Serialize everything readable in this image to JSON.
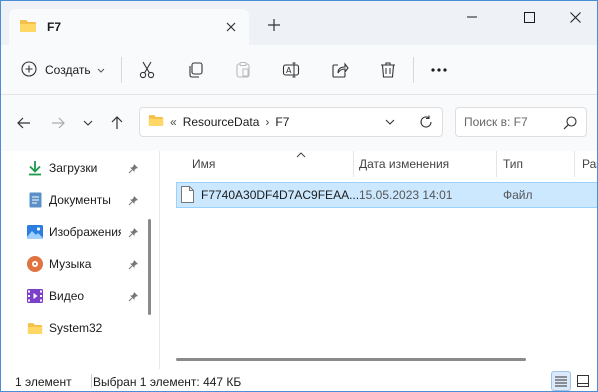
{
  "window": {
    "tab_title": "F7"
  },
  "commandbar": {
    "create_label": "Создать",
    "icons": [
      "cut-icon",
      "copy-icon",
      "paste-icon",
      "rename-icon",
      "share-icon",
      "delete-icon",
      "more-icon"
    ]
  },
  "address": {
    "overflow": "«",
    "crumbs": [
      "ResourceData",
      "F7"
    ],
    "separator": "›"
  },
  "search": {
    "placeholder": "Поиск в: F7"
  },
  "sidebar": {
    "items": [
      {
        "label": "Загрузки",
        "icon": "downloads-icon",
        "pinned": true
      },
      {
        "label": "Документы",
        "icon": "documents-icon",
        "pinned": true
      },
      {
        "label": "Изображения",
        "icon": "pictures-icon",
        "pinned": true
      },
      {
        "label": "Музыка",
        "icon": "music-icon",
        "pinned": true
      },
      {
        "label": "Видео",
        "icon": "videos-icon",
        "pinned": true
      },
      {
        "label": "System32",
        "icon": "folder-icon",
        "pinned": false
      }
    ]
  },
  "list": {
    "columns": [
      "Имя",
      "Дата изменения",
      "Тип",
      "Раз"
    ],
    "rows": [
      {
        "name": "F7740A30DF4D7AC9FEAA...",
        "date": "15.05.2023 14:01",
        "type": "Файл",
        "selected": true
      }
    ]
  },
  "status": {
    "count": "1 элемент",
    "selection": "Выбран 1 элемент: 447 КБ"
  },
  "colors": {
    "accent": "#0078d4",
    "selection_bg": "#cce8ff",
    "selection_border": "#99d1ff",
    "folder": "#f4c04a"
  }
}
